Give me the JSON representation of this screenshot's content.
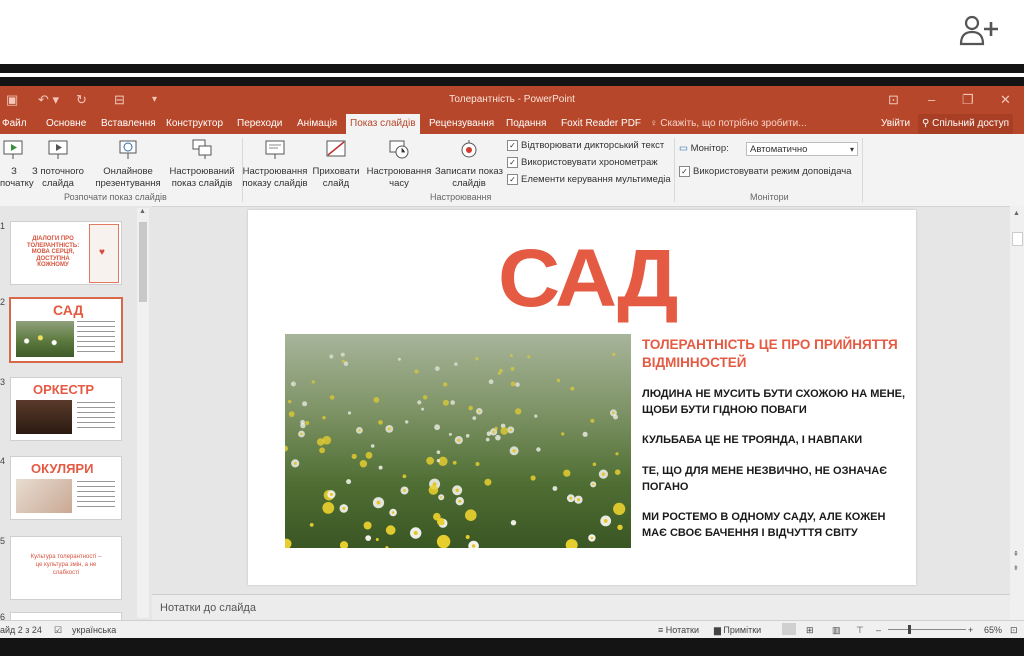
{
  "title": "Толерантність - PowerPoint",
  "tabs": [
    "Файл",
    "Основне",
    "Вставлення",
    "Конструктор",
    "Переходи",
    "Анімація",
    "Показ слайдів",
    "Рецензування",
    "Подання",
    "Foxit Reader PDF"
  ],
  "tell_me": "Скажіть, що потрібно зробити...",
  "sign_in": "Увійти",
  "share": "Спільний доступ",
  "ribbon": {
    "b_begin": "З початку",
    "b_current": "З поточного слайда",
    "b_online": "Онлайнове презентування",
    "b_custom": "Настроюваний показ слайдів",
    "g_start": "Розпочати показ слайдів",
    "b_setup": "Настроювання показу слайдів",
    "b_hide": "Приховати слайд",
    "b_rehearse": "Настроювання часу",
    "b_record": "Записати показ слайдів",
    "c_narr": "Відтворювати дикторський текст",
    "c_timings": "Використовувати хронометраж",
    "c_controls": "Елементи керування мультимедіа",
    "g_setup": "Настроювання",
    "monitor_label": "Монітор:",
    "monitor_value": "Автоматично",
    "c_presenter": "Використовувати режим доповідача",
    "g_monitors": "Монітори"
  },
  "thumbs": [
    {
      "num": "1",
      "text": "ДІАЛОГИ ПРО ТОЛЕРАНТНІСТЬ: МОВА СЕРЦЯ, ДОСТУПНА КОЖНОМУ"
    },
    {
      "num": "2",
      "text": "САД"
    },
    {
      "num": "3",
      "text": "ОРКЕСТР"
    },
    {
      "num": "4",
      "text": "ОКУЛЯРИ"
    },
    {
      "num": "5",
      "text": "Культура толерантності – це культура змін, а не слабкості"
    },
    {
      "num": "6",
      "text": ""
    }
  ],
  "slide": {
    "heading": "САД",
    "subtitle": "ТОЛЕРАНТНІСТЬ ЦЕ ПРО ПРИЙНЯТТЯ ВІДМІННОСТЕЙ",
    "p1": "ЛЮДИНА НЕ МУСИТЬ БУТИ СХОЖОЮ НА МЕНЕ, ЩОБИ БУТИ ГІДНОЮ ПОВАГИ",
    "p2": "КУЛЬБАБА ЦЕ НЕ ТРОЯНДА, І НАВПАКИ",
    "p3": "ТЕ, ЩО ДЛЯ МЕНЕ НЕЗВИЧНО, НЕ ОЗНАЧАЄ ПОГАНО",
    "p4": "МИ РОСТЕМО В ОДНОМУ САДУ, АЛЕ КОЖЕН МАЄ СВОЄ БАЧЕННЯ І ВІДЧУТТЯ СВІТУ"
  },
  "notes_placeholder": "Нотатки до слайда",
  "status": {
    "slide": "айд 2 з 24",
    "language": "українська",
    "notes": "Нотатки",
    "comments": "Примітки",
    "zoom": "65%"
  },
  "colors": {
    "accent": "#b7472a",
    "slide_red": "#e55a43"
  }
}
